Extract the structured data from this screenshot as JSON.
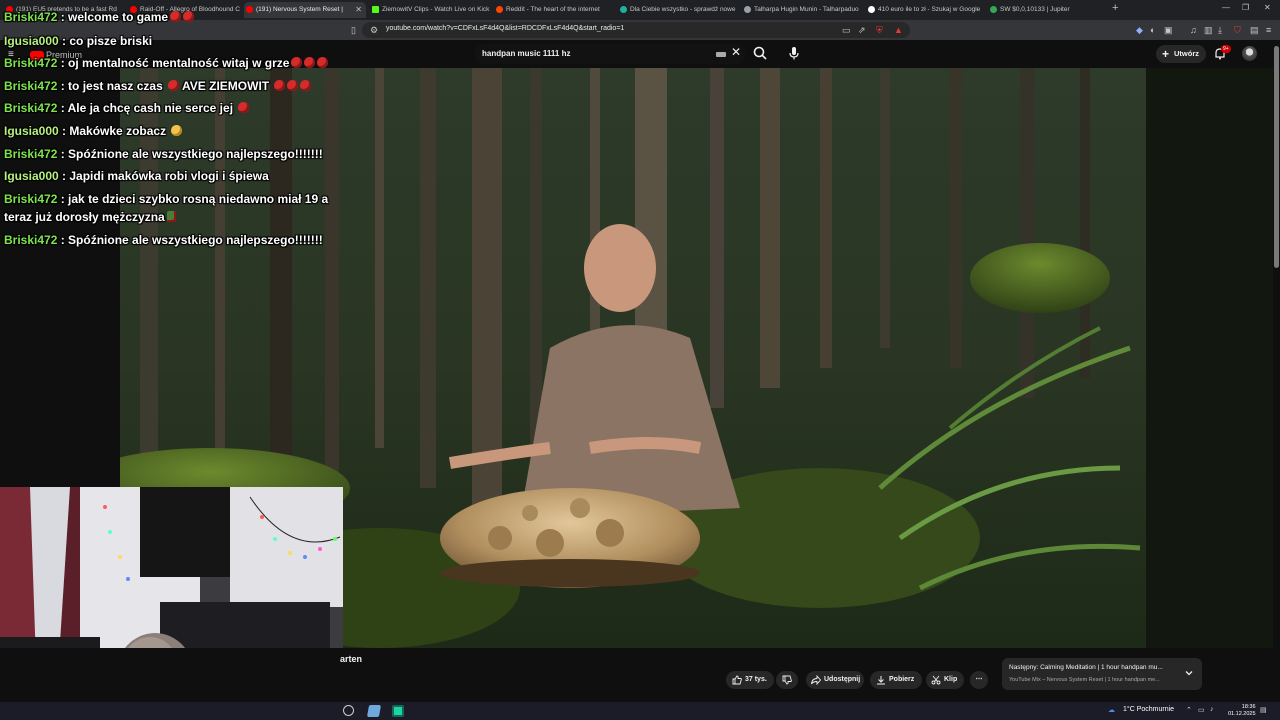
{
  "browser": {
    "tabs": [
      {
        "label": "(191) EU5 pretends to be a fast Rd",
        "color": "#ff0000"
      },
      {
        "label": "Raid-Off - Allegro of Bloodhound C",
        "color": "#ff0000"
      },
      {
        "label": "(191) Nervous System Reset |",
        "color": "#ff0000",
        "active": true
      },
      {
        "label": "ZiemowitV Clips - Watch Live on Kick",
        "color": "#53fc18"
      },
      {
        "label": "Reddit - The heart of the internet",
        "color": "#ff4500"
      },
      {
        "label": "Dla Ciebie wszystko - sprawdź nowe",
        "color": "#1db3a0"
      },
      {
        "label": "Talharpa Hugin Munin - Talharpaduo",
        "color": "#9aa0a6"
      },
      {
        "label": "410 euro ile to zł - Szukaj w Google",
        "color": "#ffffff"
      },
      {
        "label": "SW $0,0,10133 | Jupiter",
        "color": "#34a853"
      }
    ],
    "url": "youtube.com/watch?v=CDFxLsF4d4Q&list=RDCDFxLsF4d4Q&start_radio=1"
  },
  "youtube": {
    "logo_text": "Premium",
    "search_query": "handpan music 1111 hz",
    "create_label": "Utwórz",
    "notification_count": "9+",
    "video_title_fragment": "arten",
    "actions": {
      "likes": "37 tys.",
      "share": "Udostępnij",
      "download": "Pobierz",
      "clip": "Klip"
    },
    "up_next": {
      "label": "Następny: Calming Meditation | 1 hour handpan mu...",
      "sub": "YouTube Mix – Nervous System Reset | 1 hour handpan me..."
    }
  },
  "chat": [
    {
      "user": "Briski472",
      "text": "welcome to game",
      "emotes": [
        "devil",
        "devil"
      ]
    },
    {
      "user": "Igusia000",
      "text": "co pisze briski",
      "emotes": []
    },
    {
      "user": "Briski472",
      "text": "oj mentalność mentalność witaj w grze",
      "emotes": [
        "devil",
        "devil",
        "devil"
      ]
    },
    {
      "user": "Briski472",
      "text": "to jest nasz czas",
      "emotes": [
        "devil"
      ],
      "text2": "AVE ZIEMOWIT",
      "emotes2": [
        "devil",
        "devil",
        "devil"
      ]
    },
    {
      "user": "Briski472",
      "text": "Ale ja chcę cash nie serce jej",
      "emotes": [
        "devil"
      ]
    },
    {
      "user": "Igusia000",
      "text": "Makówke zobacz",
      "emotes": [
        "cat"
      ]
    },
    {
      "user": "Briski472",
      "text": "Spóźnione ale wszystkiego najlepszego!!!!!!!",
      "emotes": []
    },
    {
      "user": "Igusia000",
      "text": "Japidi makówka robi vlogi i śpiewa",
      "emotes": []
    },
    {
      "user": "Briski472",
      "text": "jak te dzieci szybko rosną niedawno miał 19 a teraz już dorosły mężczyzna",
      "emotes": [
        "flag"
      ]
    },
    {
      "user": "Briski472",
      "text": "Spóźnione ale wszystkiego najlepszego!!!!!!!",
      "emotes": []
    }
  ],
  "taskbar": {
    "weather": "1°C  Pochmurnie",
    "time": "18:36",
    "date": "01.12.2025"
  }
}
